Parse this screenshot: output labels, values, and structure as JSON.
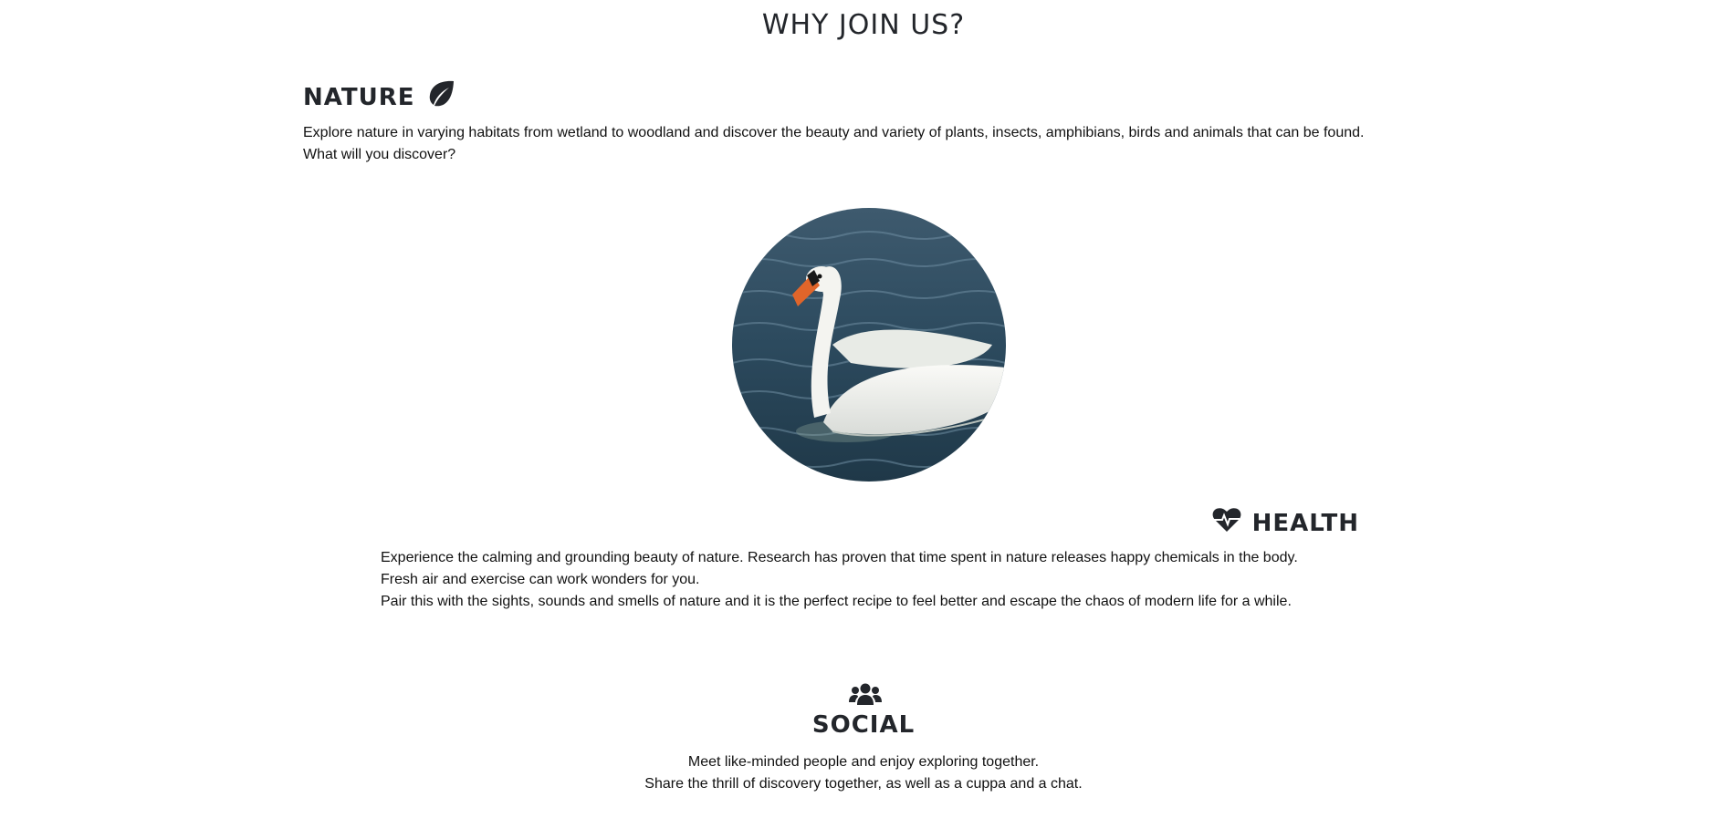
{
  "page": {
    "title": "WHY JOIN US?"
  },
  "nature": {
    "heading": "NATURE",
    "icon": "leaf-icon",
    "lines": [
      "Explore nature in varying habitats from wetland to woodland and discover the beauty and variety of plants, insects, amphibians, birds and animals that can be found.",
      "What will you discover?"
    ]
  },
  "image": {
    "subject": "swan-photo"
  },
  "health": {
    "heading": "HEALTH",
    "icon": "heart-pulse-icon",
    "lines": [
      "Experience the calming and grounding beauty of nature. Research has proven that time spent in nature releases happy chemicals in the body.",
      "Fresh air and exercise can work wonders for you.",
      "Pair this with the sights, sounds and smells of nature and it is the perfect recipe to feel better and escape the chaos of modern life for a while."
    ]
  },
  "social": {
    "heading": "SOCIAL",
    "icon": "people-group-icon",
    "lines": [
      "Meet like-minded people and enjoy exploring together.",
      "Share the thrill of discovery together, as well as a cuppa and a chat."
    ]
  },
  "colors": {
    "text": "#111111",
    "heading": "#23262b",
    "background": "#ffffff"
  }
}
